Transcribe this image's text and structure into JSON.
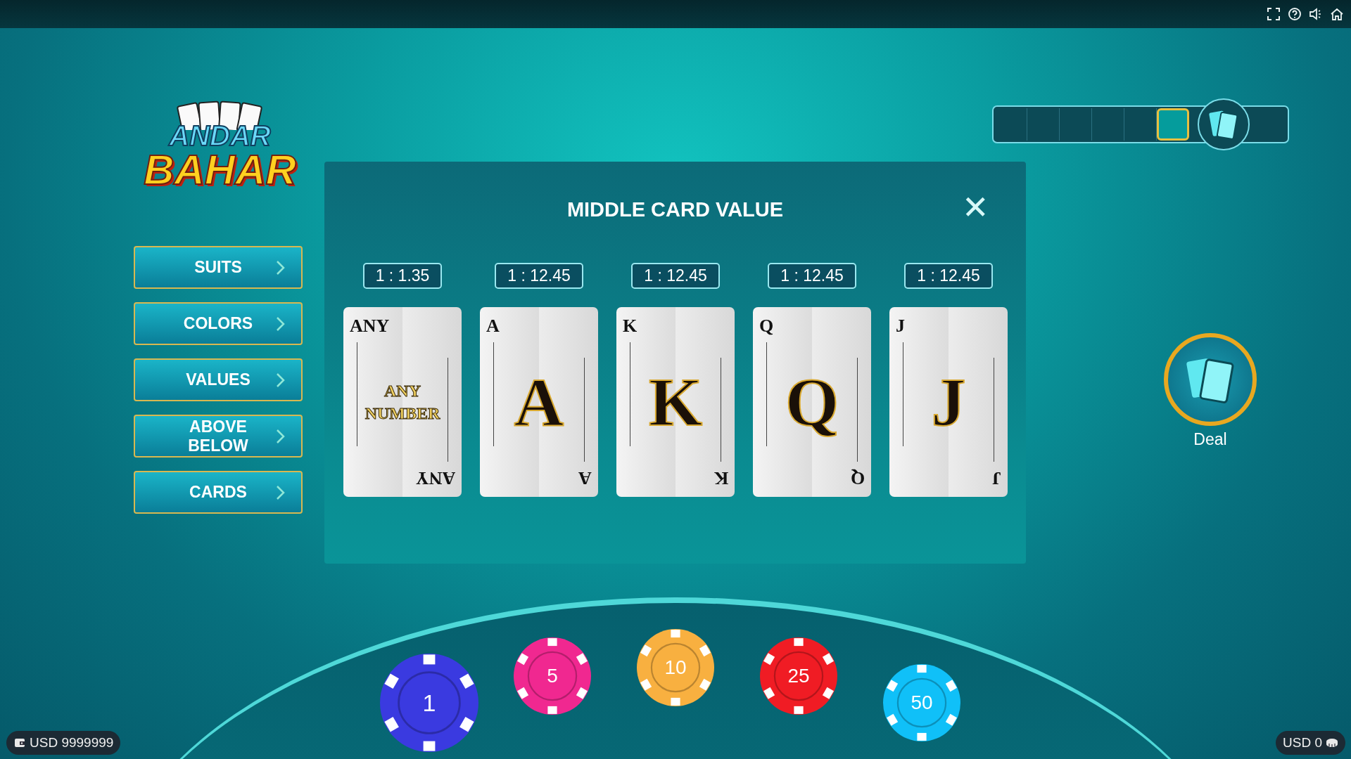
{
  "logo": {
    "line_1": "ANDAR",
    "line_2": "BAHAR"
  },
  "menu": [
    {
      "label": "SUITS"
    },
    {
      "label": "COLORS"
    },
    {
      "label": "VALUES"
    },
    {
      "label": "ABOVE\nBELOW"
    },
    {
      "label": "CARDS"
    }
  ],
  "deal_track": {
    "slots": [
      {
        "selected": false
      },
      {
        "selected": false
      },
      {
        "selected": false
      },
      {
        "selected": false
      },
      {
        "selected": false
      },
      {
        "selected": true
      }
    ]
  },
  "dialog": {
    "title": "MIDDLE CARD VALUE",
    "close": "✕",
    "options": [
      {
        "odds": "1 : 1.35",
        "corner_top": "ANY",
        "center": "ANY NUMBER",
        "corner_bottom": "ANY",
        "kind": "any"
      },
      {
        "odds": "1 : 12.45",
        "corner_top": "A",
        "center": "A",
        "corner_bottom": "A",
        "kind": "rank"
      },
      {
        "odds": "1 : 12.45",
        "corner_top": "K",
        "center": "K",
        "corner_bottom": "K",
        "kind": "rank"
      },
      {
        "odds": "1 : 12.45",
        "corner_top": "Q",
        "center": "Q",
        "corner_bottom": "Q",
        "kind": "rank"
      },
      {
        "odds": "1 : 12.45",
        "corner_top": "J",
        "center": "J",
        "corner_bottom": "J",
        "kind": "rank"
      }
    ]
  },
  "deal_button": {
    "label": "Deal"
  },
  "chips": [
    {
      "value": "1",
      "color": "#3a3ae0",
      "selected": true
    },
    {
      "value": "5",
      "color": "#f02890",
      "selected": false
    },
    {
      "value": "10",
      "color": "#f8b040",
      "selected": false
    },
    {
      "value": "25",
      "color": "#f01c24",
      "selected": false
    },
    {
      "value": "50",
      "color": "#10c0f8",
      "selected": false
    }
  ],
  "balance": "USD 9999999",
  "bet": "USD 0"
}
